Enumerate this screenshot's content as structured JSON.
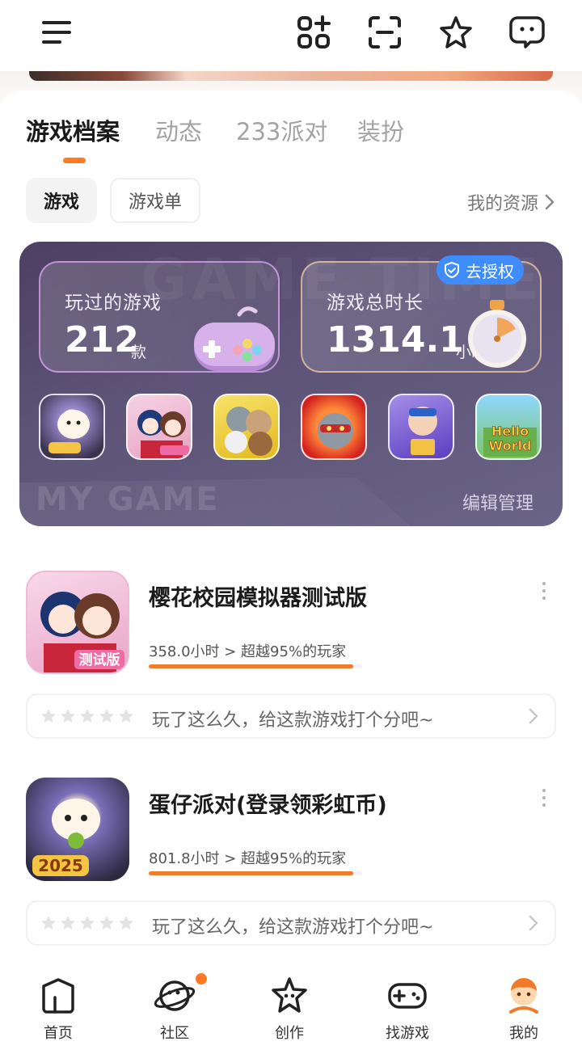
{
  "header": {
    "icons": [
      "menu-icon",
      "apps-add-icon",
      "scan-icon",
      "star-icon",
      "message-icon"
    ]
  },
  "tabs": [
    {
      "label": "游戏档案",
      "active": true
    },
    {
      "label": "动态",
      "active": false
    },
    {
      "label": "233派对",
      "active": false
    },
    {
      "label": "装扮",
      "active": false
    }
  ],
  "subtabs": [
    {
      "label": "游戏",
      "active": true
    },
    {
      "label": "游戏单",
      "active": false
    }
  ],
  "my_resources_label": "我的资源",
  "summary": {
    "played_label": "玩过的游戏",
    "played_value": "212",
    "played_unit": "款",
    "time_label": "游戏总时长",
    "time_value": "1314.1",
    "time_unit": "小时",
    "auth_label": "去授权",
    "watermark_top": "GAME TIME",
    "watermark_bottom": "MY GAME",
    "edit_label": "编辑管理",
    "icons": [
      "egg-party-icon",
      "sakura-school-icon",
      "talking-tom-friends-icon",
      "talking-tom-hero-icon",
      "kart-racer-icon",
      "hello-world-icon"
    ]
  },
  "games": [
    {
      "title": "樱花校园模拟器测试版",
      "stats": "358.0小时 > 超越95%的玩家",
      "progress": 0.96,
      "rate_prompt": "玩了这么久，给这款游戏打个分吧~",
      "badge": "测试版"
    },
    {
      "title": "蛋仔派对(登录领彩虹币)",
      "stats": "801.8小时 > 超越95%的玩家",
      "progress": 0.96,
      "rate_prompt": "玩了这么久，给这款游戏打个分吧~",
      "badge": "2025"
    }
  ],
  "colors": {
    "accent": "#ff7a22",
    "progress": "#ef7d2e",
    "card_bg": "#5c5376",
    "auth_blue": "#3f8cff"
  },
  "bottom_nav": [
    {
      "label": "首页",
      "icon": "home-icon"
    },
    {
      "label": "社区",
      "icon": "community-planet-icon",
      "badge_dot": true
    },
    {
      "label": "创作",
      "icon": "create-star-icon"
    },
    {
      "label": "找游戏",
      "icon": "gamepad-icon"
    },
    {
      "label": "我的",
      "icon": "profile-avatar-icon",
      "active": true
    }
  ]
}
